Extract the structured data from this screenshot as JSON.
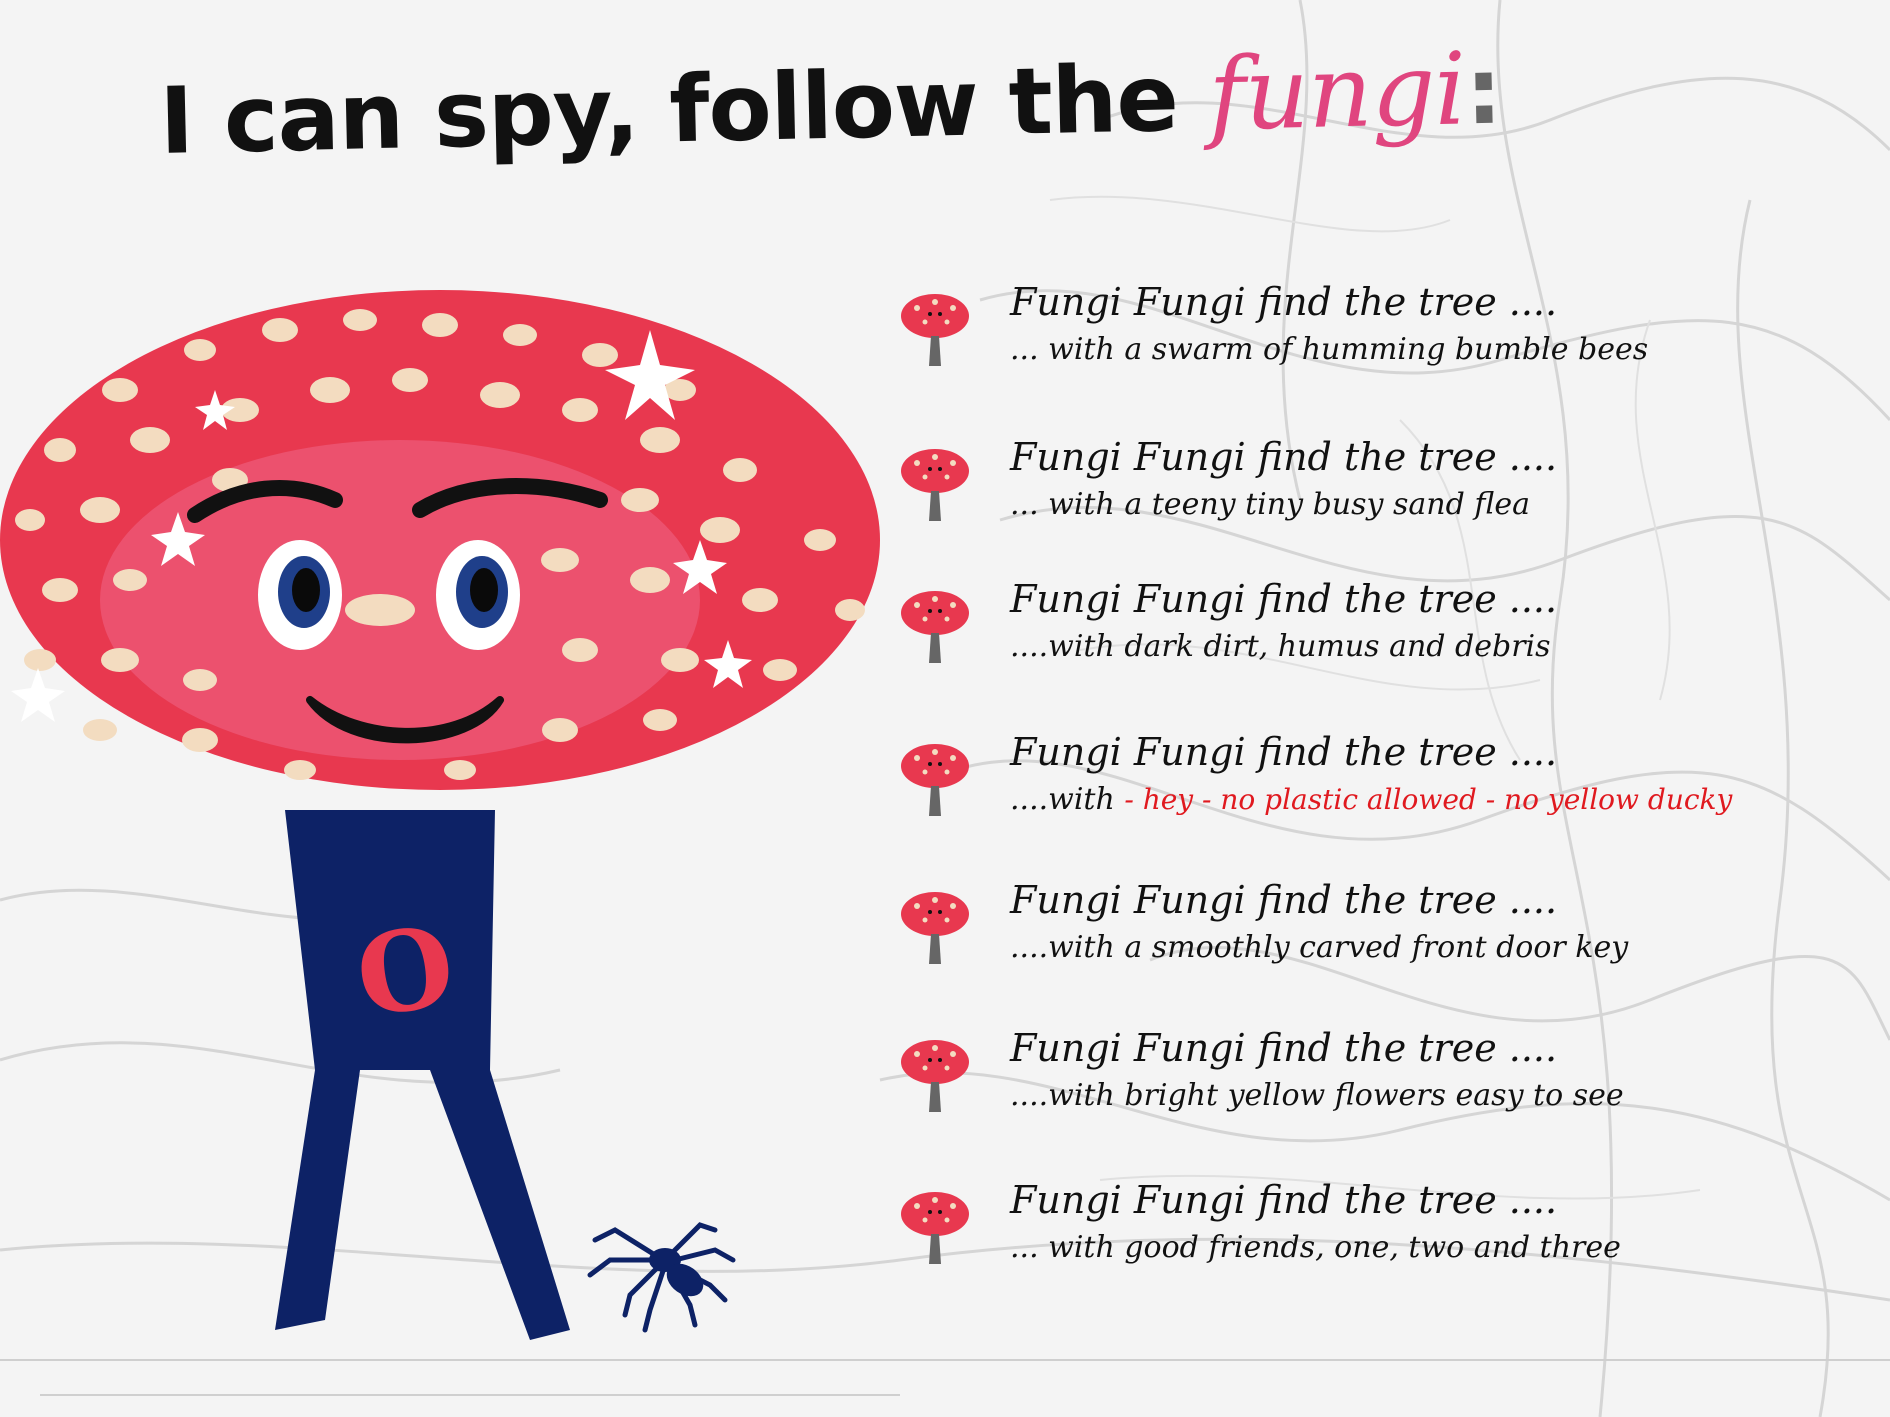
{
  "title": {
    "prefix": "I can spy, follow the ",
    "accent": "fungi",
    "suffix": ":"
  },
  "character": {
    "shirt_letter": "O",
    "colors": {
      "cap": "#e8384f",
      "spots": "#f3dcc0",
      "shirt": "#0d2266",
      "letter": "#e8384f"
    }
  },
  "verses": [
    {
      "line1": "Fungi Fungi find the tree ....",
      "line2": "... with a swarm of humming bumble bees",
      "line2_red": ""
    },
    {
      "line1": "Fungi Fungi find the tree ....",
      "line2": "... with a teeny tiny busy sand flea",
      "line2_red": ""
    },
    {
      "line1": "Fungi Fungi find the tree ....",
      "line2": "....with dark dirt, humus and debris",
      "line2_red": ""
    },
    {
      "line1": "Fungi Fungi find the tree ....",
      "line2": "....with ",
      "line2_red": "- hey - no plastic allowed - no yellow ducky"
    },
    {
      "line1": "Fungi Fungi find the tree ....",
      "line2": "....with a smoothly carved front door key",
      "line2_red": ""
    },
    {
      "line1": "Fungi Fungi find the tree ....",
      "line2": "....with bright yellow flowers easy to see",
      "line2_red": ""
    },
    {
      "line1": "Fungi Fungi find the tree ....",
      "line2": "... with good friends, one, two and three",
      "line2_red": ""
    }
  ]
}
